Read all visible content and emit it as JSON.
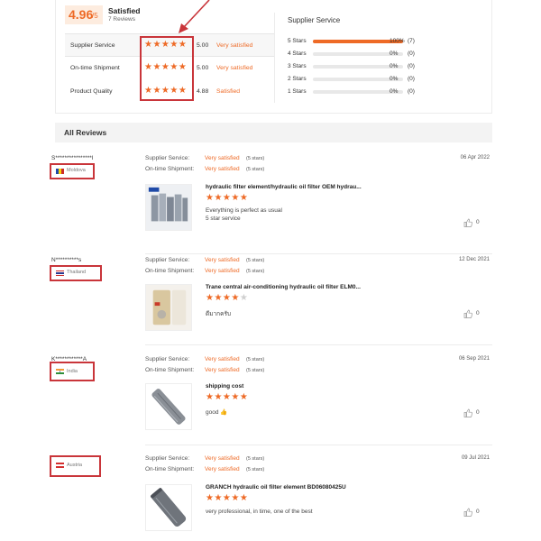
{
  "summary": {
    "score": "4.96",
    "score_suffix": "/5",
    "title": "Satisfied",
    "reviews_count": "7 Reviews",
    "metrics": [
      {
        "label": "Supplier Service",
        "stars": "★★★★★",
        "value": "5.00",
        "desc": "Very satisfied"
      },
      {
        "label": "On-time Shipment",
        "stars": "★★★★★",
        "value": "5.00",
        "desc": "Very satisfied"
      },
      {
        "label": "Product Quality",
        "stars": "★★★★★",
        "value": "4.88",
        "desc": "Satisfied"
      }
    ],
    "supplier_service_title": "Supplier Service",
    "distribution": [
      {
        "label": "5 Stars",
        "fraction": 1.0,
        "pct": "100%",
        "count": "(7)"
      },
      {
        "label": "4 Stars",
        "fraction": 0.0,
        "pct": "0%",
        "count": "(0)"
      },
      {
        "label": "3 Stars",
        "fraction": 0.0,
        "pct": "0%",
        "count": "(0)"
      },
      {
        "label": "2 Stars",
        "fraction": 0.0,
        "pct": "0%",
        "count": "(0)"
      },
      {
        "label": "1 Stars",
        "fraction": 0.0,
        "pct": "0%",
        "count": "(0)"
      }
    ]
  },
  "all_reviews_label": "All Reviews",
  "colors": {
    "accent": "#ee6a26",
    "highlight": "#c9353a"
  },
  "reviews": [
    {
      "user": "S****************l",
      "country": "Moldova",
      "date": "06 Apr 2022",
      "supplier_label": "Supplier Service:",
      "supplier_value": "Very satisfied",
      "supplier_stars": "(5 stars)",
      "shipment_label": "On-time Shipment:",
      "shipment_value": "Very satisfied",
      "shipment_stars": "(5 stars)",
      "product": "hydraulic filter element/hydraulic oil filter OEM hydrau...",
      "stars": "★★★★★",
      "stars_off": "",
      "comment1": "Everything is perfect as usual",
      "comment2": "5 star service",
      "likes": "0"
    },
    {
      "user": "N**********s",
      "country": "Thailand",
      "date": "12 Dec 2021",
      "supplier_label": "Supplier Service:",
      "supplier_value": "Very satisfied",
      "supplier_stars": "(5 stars)",
      "shipment_label": "On-time Shipment:",
      "shipment_value": "Very satisfied",
      "shipment_stars": "(5 stars)",
      "product": "Trane central air-conditioning hydraulic oil filter ELM0...",
      "stars": "★★★★",
      "stars_off": "★",
      "comment1": "ดีมากครับ",
      "comment2": "",
      "likes": "0"
    },
    {
      "user": "K************A",
      "country": "India",
      "date": "06 Sep 2021",
      "supplier_label": "Supplier Service:",
      "supplier_value": "Very satisfied",
      "supplier_stars": "(5 stars)",
      "shipment_label": "On-time Shipment:",
      "shipment_value": "Very satisfied",
      "shipment_stars": "(5 stars)",
      "product": "shipping cost",
      "stars": "★★★★★",
      "stars_off": "",
      "comment1": "good 👍",
      "comment2": "",
      "likes": "0"
    },
    {
      "user": "",
      "country": "Austria",
      "date": "09 Jul 2021",
      "supplier_label": "Supplier Service:",
      "supplier_value": "Very satisfied",
      "supplier_stars": "(5 stars)",
      "shipment_label": "On-time Shipment:",
      "shipment_value": "Very satisfied",
      "shipment_stars": "(5 stars)",
      "product": "GRANCH hydraulic oil filter element BD06080425U",
      "stars": "★★★★★",
      "stars_off": "",
      "comment1": "very professional, in time, one of the best",
      "comment2": "",
      "likes": "0"
    }
  ]
}
